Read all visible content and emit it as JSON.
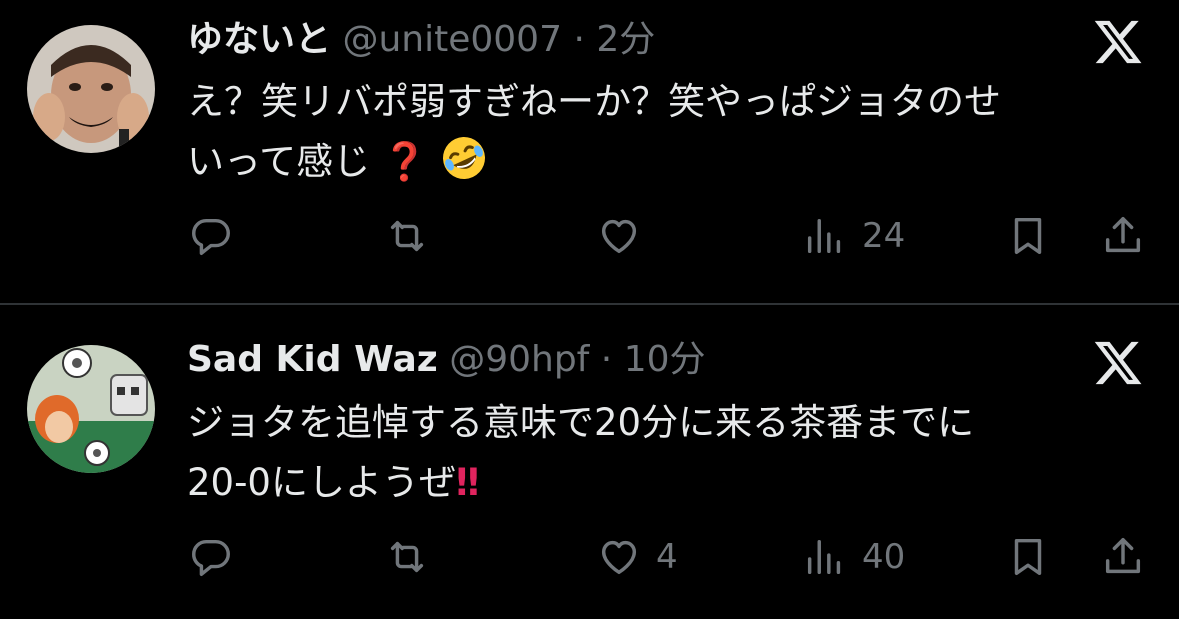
{
  "tweets": [
    {
      "name": "ゆないと",
      "handle": "@unite0007",
      "separator": "·",
      "time": "2分",
      "text_lines": [
        "え？笑リバポ弱すぎねーか？笑やっぱジョタのせ",
        "いって感じ"
      ],
      "emoji": [
        "red-question-mark",
        "rolling-on-the-floor-laughing"
      ],
      "emoji_text": "❓",
      "replies": "",
      "retweets": "",
      "likes": "",
      "views": "24"
    },
    {
      "name": "Sad Kid Waz",
      "handle": "@90hpf",
      "separator": "·",
      "time": "10分",
      "text_lines": [
        "ジョタを追悼する意味で20分に来る茶番までに",
        "20-0にしようぜ"
      ],
      "emoji": [
        "double-exclamation-mark"
      ],
      "emoji_text": "‼",
      "replies": "",
      "retweets": "",
      "likes": "4",
      "views": "40"
    }
  ],
  "colors": {
    "background": "#000000",
    "text_primary": "#e7e9ea",
    "text_secondary": "#71767b",
    "divider": "#2f3336",
    "emoji_red": "#e0245e"
  },
  "icons": {
    "logo": "x-logo-icon",
    "reply": "reply-icon",
    "retweet": "retweet-icon",
    "like": "heart-icon",
    "views": "views-icon",
    "bookmark": "bookmark-icon",
    "share": "share-icon"
  }
}
